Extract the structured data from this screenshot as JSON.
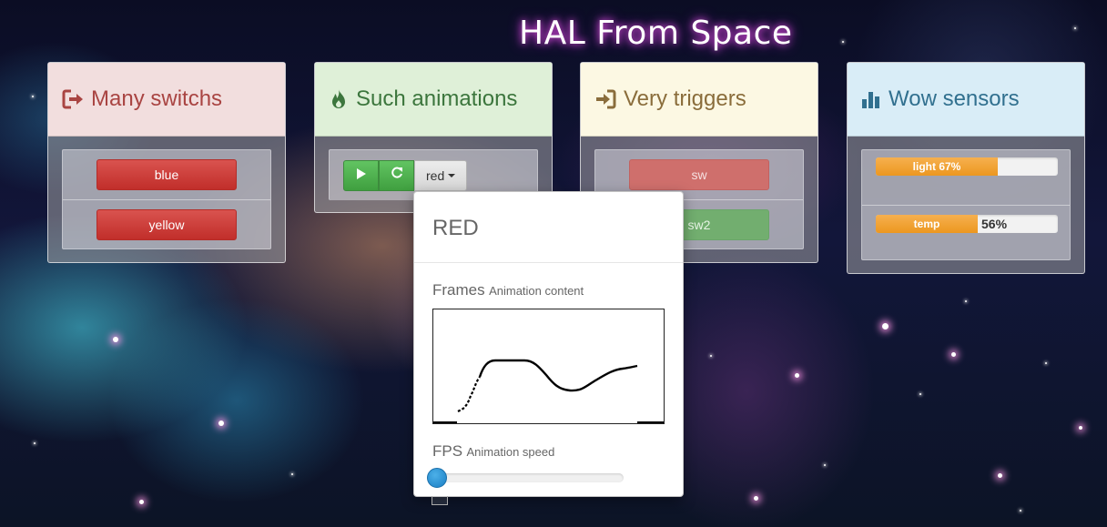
{
  "app": {
    "title": "HAL From Space"
  },
  "panels": {
    "switches": {
      "title": "Many switchs",
      "icon": "sign-out-icon",
      "buttons": [
        "blue",
        "yellow"
      ]
    },
    "animations": {
      "title": "Such animations",
      "icon": "fire-icon",
      "play_icon": "play-icon",
      "refresh_icon": "refresh-icon",
      "dropdown_label": "red"
    },
    "triggers": {
      "title": "Very triggers",
      "icon": "sign-in-icon",
      "buttons": [
        "sw",
        "sw2"
      ]
    },
    "sensors": {
      "title": "Wow sensors",
      "icon": "bar-chart-icon",
      "items": [
        {
          "label": "light 67%",
          "value": 0.67,
          "after": ""
        },
        {
          "label": "temp",
          "value": 0.56,
          "after": "56%"
        }
      ]
    }
  },
  "popover": {
    "title": "RED",
    "frames_label": "Frames",
    "frames_hint": "Animation content",
    "fps_label": "FPS",
    "fps_hint": "Animation speed",
    "fps_value": 0
  },
  "colors": {
    "danger": "#d9534f",
    "success": "#5cb85c",
    "warning": "#f0ad4e",
    "title_glow": "#e14fe0"
  }
}
